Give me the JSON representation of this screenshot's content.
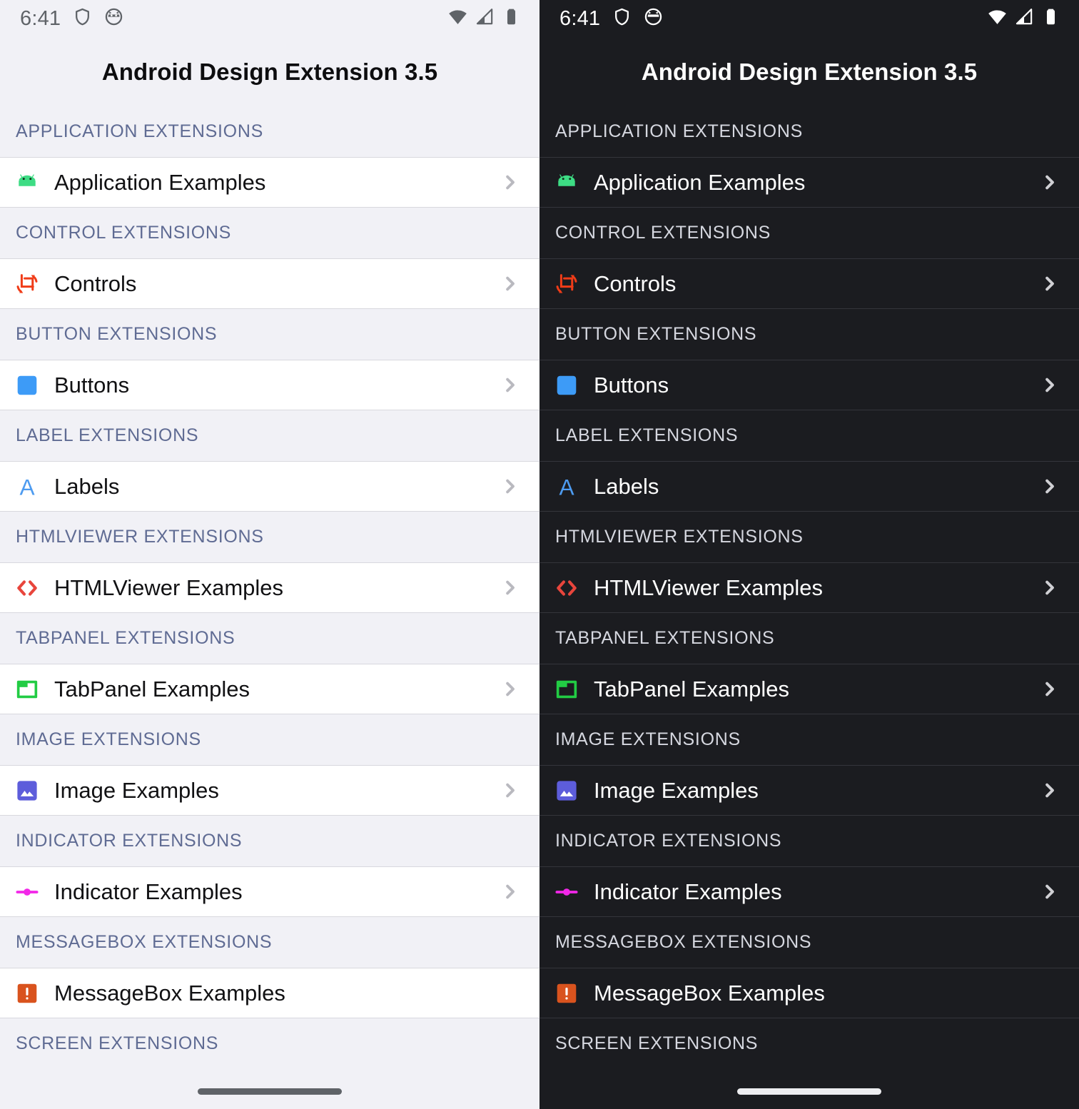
{
  "app": {
    "title": "Android Design Extension 3.5"
  },
  "status_bar": {
    "time": "6:41",
    "left_icons": [
      "shield-icon",
      "cat-face-icon"
    ],
    "right_icons": [
      "wifi-icon",
      "cellular-signal-icon",
      "battery-icon"
    ]
  },
  "panels": [
    {
      "theme": "light",
      "name": "light-theme-panel"
    },
    {
      "theme": "dark",
      "name": "dark-theme-panel"
    }
  ],
  "colors": {
    "light_background": "#f1f1f6",
    "light_row_background": "#ffffff",
    "light_section_label": "#5f6b93",
    "light_text": "#111113",
    "dark_background": "#1b1c20",
    "dark_section_label": "#d6d8e0",
    "dark_text": "#ffffff",
    "android_green": "#3ddc84",
    "controls_red": "#f03c18",
    "buttons_blue": "#3d9bf7",
    "labels_blue": "#4d9bf0",
    "htmlviewer_red": "#e8453c",
    "tabpanel_green": "#22cc44",
    "image_purple": "#5d5ddb",
    "indicator_magenta": "#f227e8",
    "messagebox_orange": "#d9531e"
  },
  "sections": [
    {
      "header": "APPLICATION EXTENSIONS",
      "item": {
        "label": "Application Examples",
        "icon": "android-robot-icon",
        "icon_color": "#3ddc84",
        "has_chevron": true
      }
    },
    {
      "header": "CONTROL EXTENSIONS",
      "item": {
        "label": "Controls",
        "icon": "crop-rotate-icon",
        "icon_color": "#f03c18",
        "has_chevron": true
      }
    },
    {
      "header": "BUTTON EXTENSIONS",
      "item": {
        "label": "Buttons",
        "icon": "rounded-square-icon",
        "icon_color": "#3d9bf7",
        "has_chevron": true
      }
    },
    {
      "header": "LABEL EXTENSIONS",
      "item": {
        "label": "Labels",
        "icon": "letter-a-icon",
        "icon_color": "#4d9bf0",
        "has_chevron": true
      }
    },
    {
      "header": "HTMLVIEWER EXTENSIONS",
      "item": {
        "label": "HTMLViewer Examples",
        "icon": "angle-brackets-icon",
        "icon_color": "#e8453c",
        "has_chevron": true
      }
    },
    {
      "header": "TABPANEL EXTENSIONS",
      "item": {
        "label": "TabPanel Examples",
        "icon": "tab-folder-icon",
        "icon_color": "#22cc44",
        "has_chevron": true
      }
    },
    {
      "header": "IMAGE EXTENSIONS",
      "item": {
        "label": "Image Examples",
        "icon": "picture-mountain-icon",
        "icon_color": "#5d5ddb",
        "has_chevron": true
      }
    },
    {
      "header": "INDICATOR EXTENSIONS",
      "item": {
        "label": "Indicator Examples",
        "icon": "slider-dot-icon",
        "icon_color": "#f227e8",
        "has_chevron": true
      }
    },
    {
      "header": "MESSAGEBOX EXTENSIONS",
      "item": {
        "label": "MessageBox Examples",
        "icon": "exclamation-square-icon",
        "icon_color": "#d9531e",
        "has_chevron": false
      }
    },
    {
      "header": "SCREEN EXTENSIONS",
      "item": null
    }
  ]
}
